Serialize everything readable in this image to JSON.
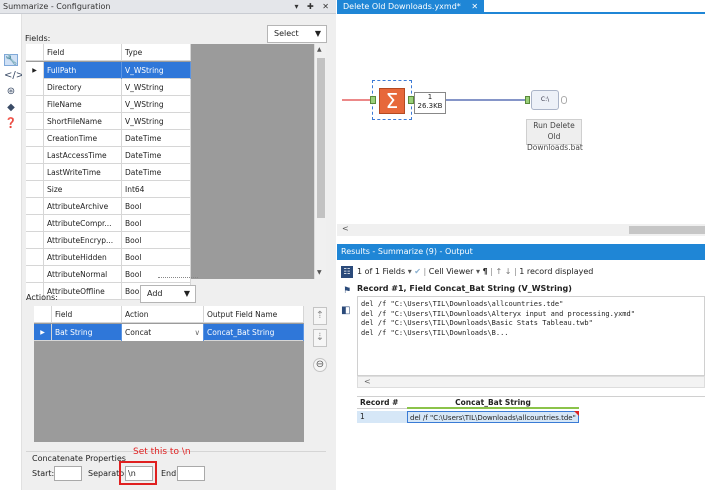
{
  "config_panel": {
    "title": "Summarize - Configuration",
    "title_controls": "▾ ✚ ✕",
    "fields_label": "Fields:",
    "select_dropdown": "Select",
    "fields_headers": [
      "Field",
      "Type"
    ],
    "fields_rows": [
      {
        "field": "FullPath",
        "type": "V_WString"
      },
      {
        "field": "Directory",
        "type": "V_WString"
      },
      {
        "field": "FileName",
        "type": "V_WString"
      },
      {
        "field": "ShortFileName",
        "type": "V_WString"
      },
      {
        "field": "CreationTime",
        "type": "DateTime"
      },
      {
        "field": "LastAccessTime",
        "type": "DateTime"
      },
      {
        "field": "LastWriteTime",
        "type": "DateTime"
      },
      {
        "field": "Size",
        "type": "Int64"
      },
      {
        "field": "AttributeArchive",
        "type": "Bool"
      },
      {
        "field": "AttributeCompr...",
        "type": "Bool"
      },
      {
        "field": "AttributeEncryp...",
        "type": "Bool"
      },
      {
        "field": "AttributeHidden",
        "type": "Bool"
      },
      {
        "field": "AttributeNormal",
        "type": "Bool"
      },
      {
        "field": "AttributeOffline",
        "type": "Bool"
      }
    ],
    "actions_label": "Actions:",
    "add_dropdown": "Add",
    "actions_headers": [
      "Field",
      "Action",
      "Output Field Name"
    ],
    "actions_rows": [
      {
        "field": "Bat String",
        "action": "Concat",
        "output": "Concat_Bat String"
      }
    ],
    "concat_title": "Concatenate Properties",
    "start_label": "Start:",
    "separator_label": "Separator:",
    "end_label": "End:",
    "start_value": "",
    "separator_value": "\\n",
    "end_value": "",
    "annotation": "Set this to \\n",
    "annotation_color": "#e02020"
  },
  "workflow": {
    "tab_label": "Delete Old Downloads.yxmd*",
    "tab_close": "✕",
    "record_count": "1",
    "data_size": "26.3KB",
    "run_tool_label_1": "Run Delete Old",
    "run_tool_label_2": "Downloads.bat",
    "accent": "#1f86d6"
  },
  "results": {
    "title": "Results - Summarize (9) - Output",
    "fields_count": "1 of 1 Fields",
    "cell_viewer": "Cell Viewer",
    "pilcrow": "¶",
    "records_displayed": "1 record displayed",
    "record_header": "Record #1, Field Concat_Bat String (V_WString)",
    "text_lines": [
      "del /f \"C:\\Users\\TIL\\Downloads\\allcountries.tde\"",
      "del /f \"C:\\Users\\TIL\\Downloads\\Alteryx input and processing.yxmd\"",
      "del /f \"C:\\Users\\TIL\\Downloads\\Basic Stats Tableau.twb\"",
      "del /f \"C:\\Users\\TIL\\Downloads\\B..."
    ],
    "grid_headers": [
      "Record #",
      "Concat_Bat String"
    ],
    "grid_rows": [
      {
        "record": "1",
        "value": "del /f \"C:\\Users\\TIL\\Downloads\\allcountries.tde\""
      }
    ]
  }
}
